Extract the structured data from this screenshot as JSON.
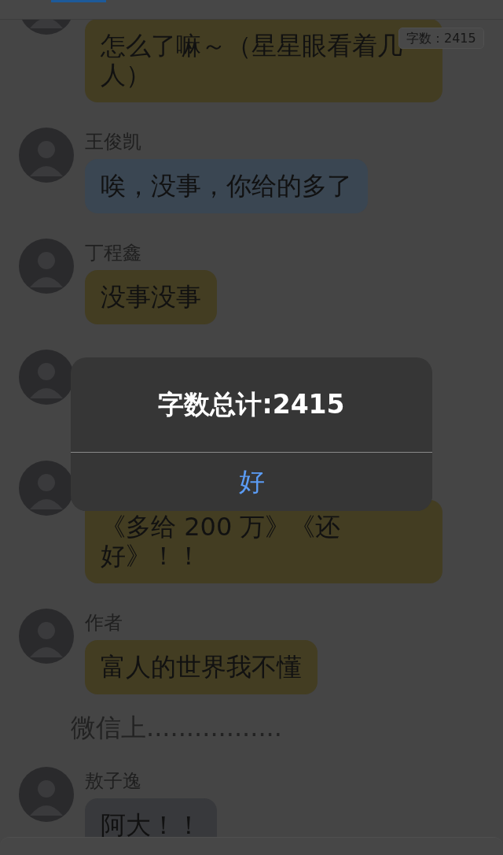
{
  "word_count_badge": "字数：2415",
  "messages": [
    {
      "kind": "message",
      "text": "怎么了嘛～（星星眼看着几人）",
      "color": "#433d22"
    },
    {
      "kind": "message",
      "sender": "王俊凯",
      "text": "唉，没事，你给的多了",
      "color": "#3a4652"
    },
    {
      "kind": "message",
      "sender": "丁程鑫",
      "text": "没事没事",
      "color": "#433d22"
    },
    {
      "kind": "message"
    },
    {
      "kind": "message",
      "text": "《多给 200 万》《还好》！！",
      "color": "#433d22"
    },
    {
      "kind": "message",
      "sender": "作者",
      "text": "富人的世界我不懂",
      "color": "#433d22"
    },
    {
      "kind": "narration",
      "text": "微信上................."
    },
    {
      "kind": "message",
      "sender": "敖子逸",
      "text": "阿大！！",
      "color": "#38393c"
    }
  ],
  "dialog": {
    "title": "字数总计:2415",
    "button": "好"
  }
}
